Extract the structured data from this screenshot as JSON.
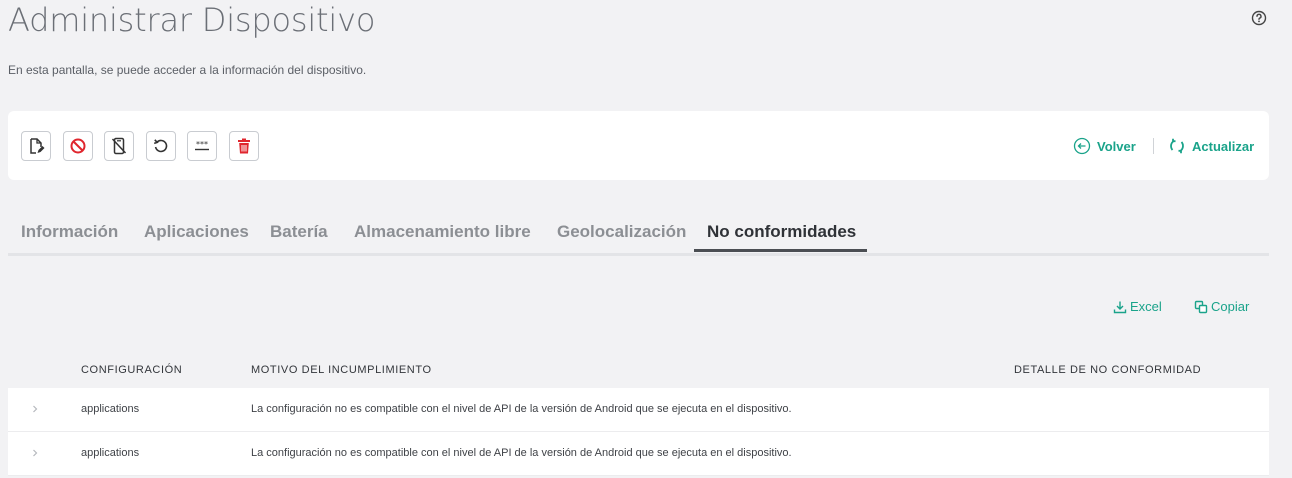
{
  "header": {
    "title": "Administrar Dispositivo",
    "subtitle": "En esta pantalla, se puede acceder a la información del dispositivo."
  },
  "toolbar": {
    "icons": [
      "edit-file-icon",
      "block-icon",
      "no-phone-icon",
      "undo-icon",
      "password-icon",
      "trash-icon"
    ],
    "back_label": "Volver",
    "refresh_label": "Actualizar"
  },
  "tabs": [
    {
      "label": "Información",
      "active": false
    },
    {
      "label": "Aplicaciones",
      "active": false
    },
    {
      "label": "Batería",
      "active": false
    },
    {
      "label": "Almacenamiento libre",
      "active": false
    },
    {
      "label": "Geolocalización",
      "active": false
    },
    {
      "label": "No conformidades",
      "active": true
    }
  ],
  "export": {
    "excel_label": "Excel",
    "copy_label": "Copiar"
  },
  "table": {
    "headers": [
      "CONFIGURACIÓN",
      "MOTIVO DEL INCUMPLIMIENTO",
      "DETALLE DE NO CONFORMIDAD"
    ],
    "rows": [
      {
        "config": "applications",
        "reason": "La configuración no es compatible con el nivel de API de la versión de Android que se ejecuta en el dispositivo.",
        "detail": ""
      },
      {
        "config": "applications",
        "reason": "La configuración no es compatible con el nivel de API de la versión de Android que se ejecuta en el dispositivo.",
        "detail": ""
      }
    ]
  },
  "colors": {
    "accent": "#1aa38a",
    "danger": "#e0262e",
    "background": "#f2f2f4"
  }
}
